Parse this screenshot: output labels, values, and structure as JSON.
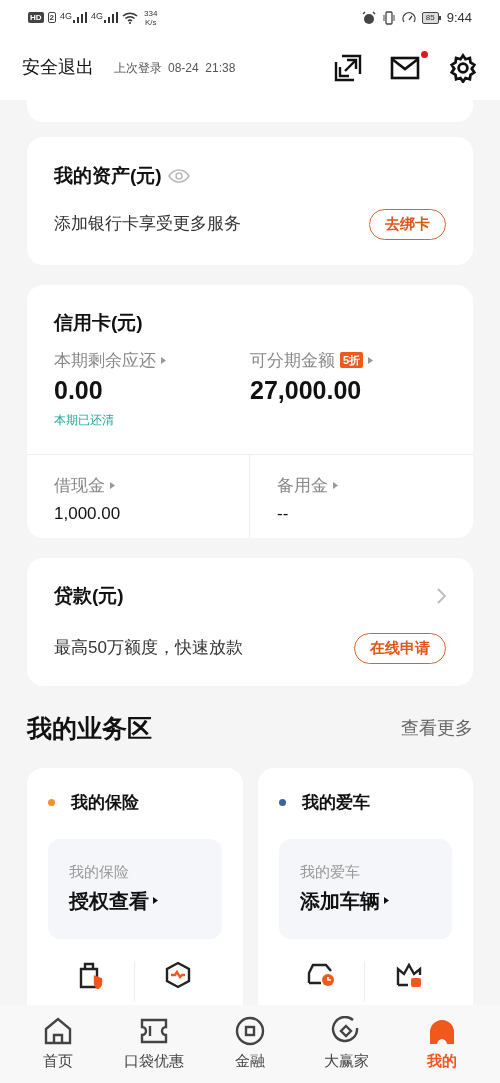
{
  "status_bar": {
    "hd": "HD",
    "sim": "2",
    "networks": [
      "4G",
      "4G"
    ],
    "speed": [
      "334",
      "K/s"
    ],
    "battery": "85",
    "time": "9:44"
  },
  "header": {
    "logout": "安全退出",
    "last_login_label": "上次登录",
    "last_login_time": "08-24  21:38",
    "mail_unread": true
  },
  "assets": {
    "title": "我的资产(元)",
    "hint": "添加银行卡享受更多服务",
    "button": "去绑卡"
  },
  "credit_card": {
    "title": "信用卡(元)",
    "stats": [
      {
        "label": "本期剩余应还",
        "value": "0.00",
        "note": "本期已还清"
      },
      {
        "label": "可分期金额",
        "badge": "5折",
        "value": "27,000.00"
      }
    ],
    "sub_stats": [
      {
        "label": "借现金",
        "value": "1,000.00"
      },
      {
        "label": "备用金",
        "value": "--"
      }
    ]
  },
  "loan": {
    "title": "贷款(元)",
    "hint": "最高50万额度，快速放款",
    "button": "在线申请"
  },
  "business": {
    "title": "我的业务区",
    "more": "查看更多",
    "cards": [
      {
        "title": "我的保险",
        "color": "#f0902e",
        "sub": "我的保险",
        "action": "授权查看",
        "services": [
          {
            "kind": "shop"
          },
          {
            "kind": "gauge"
          }
        ]
      },
      {
        "title": "我的爱车",
        "color": "#3d5fa8",
        "sub": "我的爱车",
        "action": "添加车辆",
        "services": [
          {
            "kind": "car"
          },
          {
            "kind": "crown"
          }
        ]
      }
    ]
  },
  "nav": [
    {
      "label": "首页",
      "kind": "home",
      "selected": false
    },
    {
      "label": "口袋优惠",
      "kind": "ticket",
      "selected": false
    },
    {
      "label": "金融",
      "kind": "coin",
      "selected": false
    },
    {
      "label": "大赢家",
      "kind": "diamond",
      "selected": false
    },
    {
      "label": "我的",
      "kind": "profile",
      "selected": true
    }
  ]
}
